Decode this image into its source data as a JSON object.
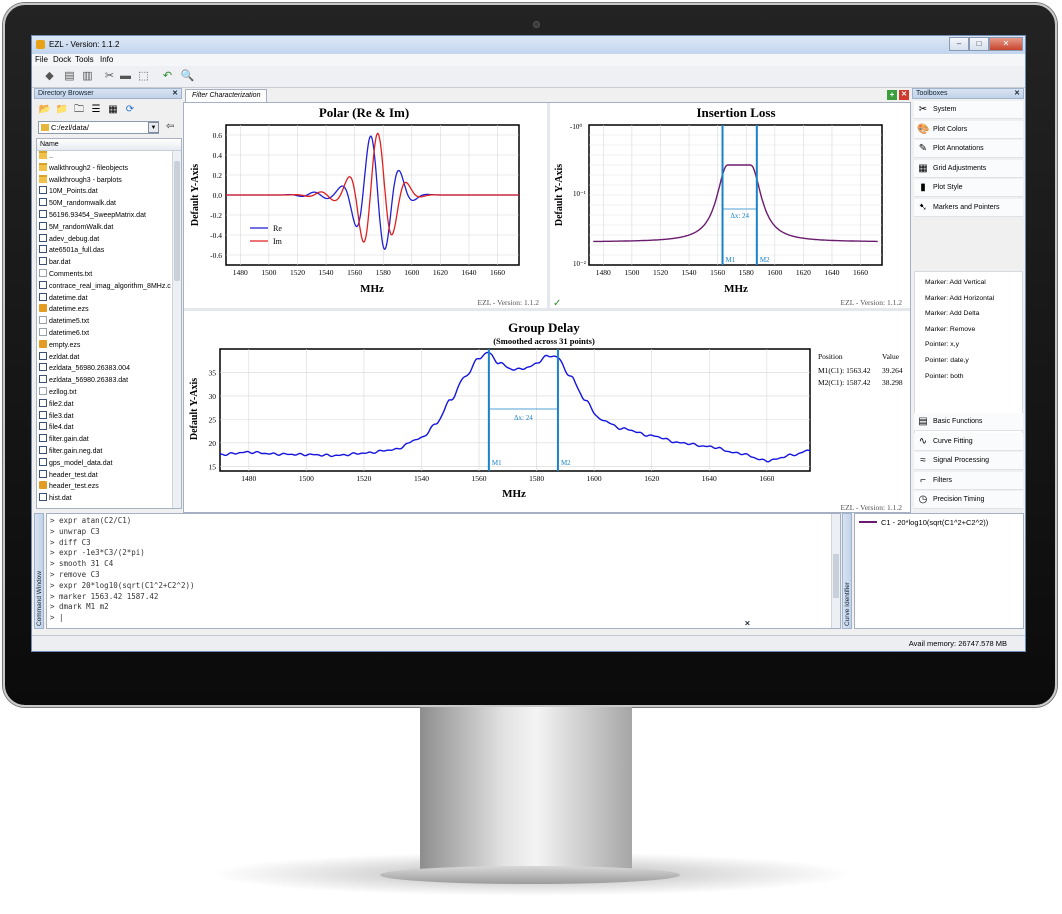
{
  "window": {
    "title": "EZL - Version: 1.1.2",
    "min": "–",
    "max": "□",
    "close": "✕"
  },
  "menu": [
    "File",
    "Dock",
    "Tools",
    "Info"
  ],
  "directory": {
    "header": "Directory Browser",
    "path": "C:/ezl/data/",
    "column": "Name",
    "files": [
      {
        "name": "..",
        "type": "folder"
      },
      {
        "name": "walkthrough2 - fileobjects",
        "type": "folder"
      },
      {
        "name": "walkthrough3 - barplots",
        "type": "folder"
      },
      {
        "name": "10M_Points.dat",
        "type": "dat"
      },
      {
        "name": "50M_randomwalk.dat",
        "type": "dat"
      },
      {
        "name": "56196.93454_SweepMatrix.dat",
        "type": "dat"
      },
      {
        "name": "5M_randomWalk.dat",
        "type": "dat"
      },
      {
        "name": "adev_debug.dat",
        "type": "dat"
      },
      {
        "name": "ate6501a_full.das",
        "type": "dat"
      },
      {
        "name": "bar.dat",
        "type": "dat"
      },
      {
        "name": "Comments.txt",
        "type": "txt"
      },
      {
        "name": "contrace_real_imag_algorithm_8MHz.c",
        "type": "dat"
      },
      {
        "name": "datetime.dat",
        "type": "dat"
      },
      {
        "name": "datetime.ezs",
        "type": "ezs"
      },
      {
        "name": "datetime5.txt",
        "type": "txt"
      },
      {
        "name": "datetime6.txt",
        "type": "txt"
      },
      {
        "name": "empty.ezs",
        "type": "ezs"
      },
      {
        "name": "ezldat.dat",
        "type": "dat"
      },
      {
        "name": "ezldata_56980.26383.004",
        "type": "dat"
      },
      {
        "name": "ezldata_56980.26383.dat",
        "type": "dat"
      },
      {
        "name": "ezllog.txt",
        "type": "txt"
      },
      {
        "name": "file2.dat",
        "type": "dat"
      },
      {
        "name": "file3.dat",
        "type": "dat"
      },
      {
        "name": "file4.dat",
        "type": "dat"
      },
      {
        "name": "filter.gain.dat",
        "type": "dat"
      },
      {
        "name": "filter.gain.neg.dat",
        "type": "dat"
      },
      {
        "name": "gps_model_data.dat",
        "type": "dat"
      },
      {
        "name": "header_test.dat",
        "type": "dat"
      },
      {
        "name": "header_test.ezs",
        "type": "ezs"
      },
      {
        "name": "hist.dat",
        "type": "dat"
      }
    ]
  },
  "plot_tab": "Filter Characterization",
  "plots": {
    "polar": {
      "title": "Polar (Re & Im)",
      "xlabel": "MHz",
      "ylabel": "Default Y-Axis",
      "legend": [
        "Re",
        "Im"
      ],
      "footer": "EZL - Version: 1.1.2"
    },
    "insertion": {
      "title": "Insertion Loss",
      "xlabel": "MHz",
      "ylabel": "Default Y-Axis",
      "footer": "EZL - Version: 1.1.2",
      "delta": "Δx: 24",
      "m1": "M1",
      "m2": "M2"
    },
    "group": {
      "title": "Group Delay",
      "subtitle": "(Smoothed across 31 points)",
      "xlabel": "MHz",
      "ylabel": "Default Y-Axis",
      "footer": "EZL - Version: 1.1.2",
      "delta": "Δx: 24",
      "m1": "M1",
      "m2": "M2",
      "table": {
        "h1": "Position",
        "h2": "Value",
        "r1a": "M1(C1): 1563.42",
        "r1b": "39.264",
        "r2a": "M2(C1): 1587.42",
        "r2b": "38.298"
      }
    }
  },
  "chart_data": [
    {
      "type": "line",
      "title": "Polar (Re & Im)",
      "xlabel": "MHz",
      "ylabel": "Default Y-Axis",
      "xlim": [
        1470,
        1675
      ],
      "ylim": [
        -0.7,
        0.7
      ],
      "xticks": [
        1480,
        1500,
        1520,
        1540,
        1560,
        1580,
        1600,
        1620,
        1640,
        1660
      ],
      "yticks": [
        0.6,
        0.4,
        0.2,
        0.0,
        -0.2,
        -0.4,
        -0.6
      ],
      "series": [
        {
          "name": "Re",
          "color": "#1f1fd6"
        },
        {
          "name": "Im",
          "color": "#e02020"
        }
      ]
    },
    {
      "type": "line",
      "title": "Insertion Loss",
      "xlabel": "MHz",
      "ylabel": "Default Y-Axis",
      "xlim": [
        1470,
        1675
      ],
      "yscale": "log",
      "yticks": [
        "-10^0",
        "10^-1",
        "10^-2"
      ],
      "xticks": [
        1480,
        1500,
        1520,
        1540,
        1560,
        1580,
        1600,
        1620,
        1640,
        1660
      ],
      "markers": [
        {
          "name": "M1",
          "x": 1563.42
        },
        {
          "name": "M2",
          "x": 1587.42
        }
      ],
      "series": [
        {
          "color": "#6b1c6e"
        }
      ]
    },
    {
      "type": "line",
      "title": "Group Delay",
      "subtitle": "(Smoothed across 31 points)",
      "xlabel": "MHz",
      "ylabel": "Default Y-Axis",
      "xlim": [
        1470,
        1675
      ],
      "ylim": [
        14,
        40
      ],
      "xticks": [
        1480,
        1500,
        1520,
        1540,
        1560,
        1580,
        1600,
        1620,
        1640,
        1660
      ],
      "yticks": [
        15,
        20,
        25,
        30,
        35
      ],
      "markers": [
        {
          "name": "M1",
          "x": 1563.42,
          "value": 39.264
        },
        {
          "name": "M2",
          "x": 1587.42,
          "value": 38.298
        }
      ],
      "series": [
        {
          "color": "#1414e0",
          "x": [
            1470,
            1480,
            1490,
            1500,
            1510,
            1520,
            1530,
            1540,
            1545,
            1550,
            1555,
            1560,
            1563,
            1567,
            1572,
            1577,
            1580,
            1584,
            1587,
            1592,
            1597,
            1602,
            1610,
            1620,
            1630,
            1640,
            1650,
            1660,
            1670,
            1675
          ],
          "y": [
            17.5,
            18.0,
            17.6,
            17.5,
            17.3,
            17.8,
            18.5,
            21,
            24,
            29,
            34,
            38,
            39.3,
            37,
            35.6,
            36,
            37,
            38.6,
            38.3,
            34,
            29,
            25,
            23,
            21.5,
            20,
            19.2,
            17.8,
            16.2,
            17.5,
            18.5
          ]
        }
      ]
    }
  ],
  "toolboxes": {
    "header": "Toolboxes",
    "top": [
      {
        "label": "System",
        "icon": "tools-icon",
        "glyph": "✂"
      },
      {
        "label": "Plot Colors",
        "icon": "palette-icon",
        "glyph": "🎨"
      },
      {
        "label": "Plot Annotations",
        "icon": "pen-icon",
        "glyph": "✎"
      },
      {
        "label": "Grid Adjustments",
        "icon": "grid-icon",
        "glyph": "▦"
      },
      {
        "label": "Plot Style",
        "icon": "bars-icon",
        "glyph": "▮"
      },
      {
        "label": "Markers and Pointers",
        "icon": "pointer-icon",
        "glyph": "➷"
      }
    ],
    "markers": [
      "Marker: Add Vertical",
      "Marker: Add Horizontal",
      "Marker: Add Delta",
      "Marker: Remove",
      "Pointer: x,y",
      "Pointer: date,y",
      "Pointer: both"
    ],
    "bottom": [
      {
        "label": "Basic Functions",
        "icon": "function-icon",
        "glyph": "▤"
      },
      {
        "label": "Curve Fitting",
        "icon": "curve-icon",
        "glyph": "∿"
      },
      {
        "label": "Signal Processing",
        "icon": "signal-icon",
        "glyph": "≈"
      },
      {
        "label": "Filters",
        "icon": "filter-icon",
        "glyph": "⌐"
      },
      {
        "label": "Precision Timing",
        "icon": "clock-icon",
        "glyph": "◷"
      }
    ]
  },
  "command": {
    "label": "Command Window",
    "lines": [
      "> expr atan(C2/C1)",
      "> unwrap C3",
      "> diff C3",
      "> expr -1e3*C3/(2*pi)",
      "> smooth 31 C4",
      "> remove C3",
      "> expr 20*log10(sqrt(C1^2+C2^2))",
      "> marker 1563.42 1587.42",
      "> dmark M1 m2",
      "> |"
    ]
  },
  "curve": {
    "label": "Curve Identifier",
    "entry": "C1 - 20*log10(sqrt(C1^2+C2^2))",
    "color": "#6a1b6f"
  },
  "status": "Avail memory: 26747.578 MB"
}
